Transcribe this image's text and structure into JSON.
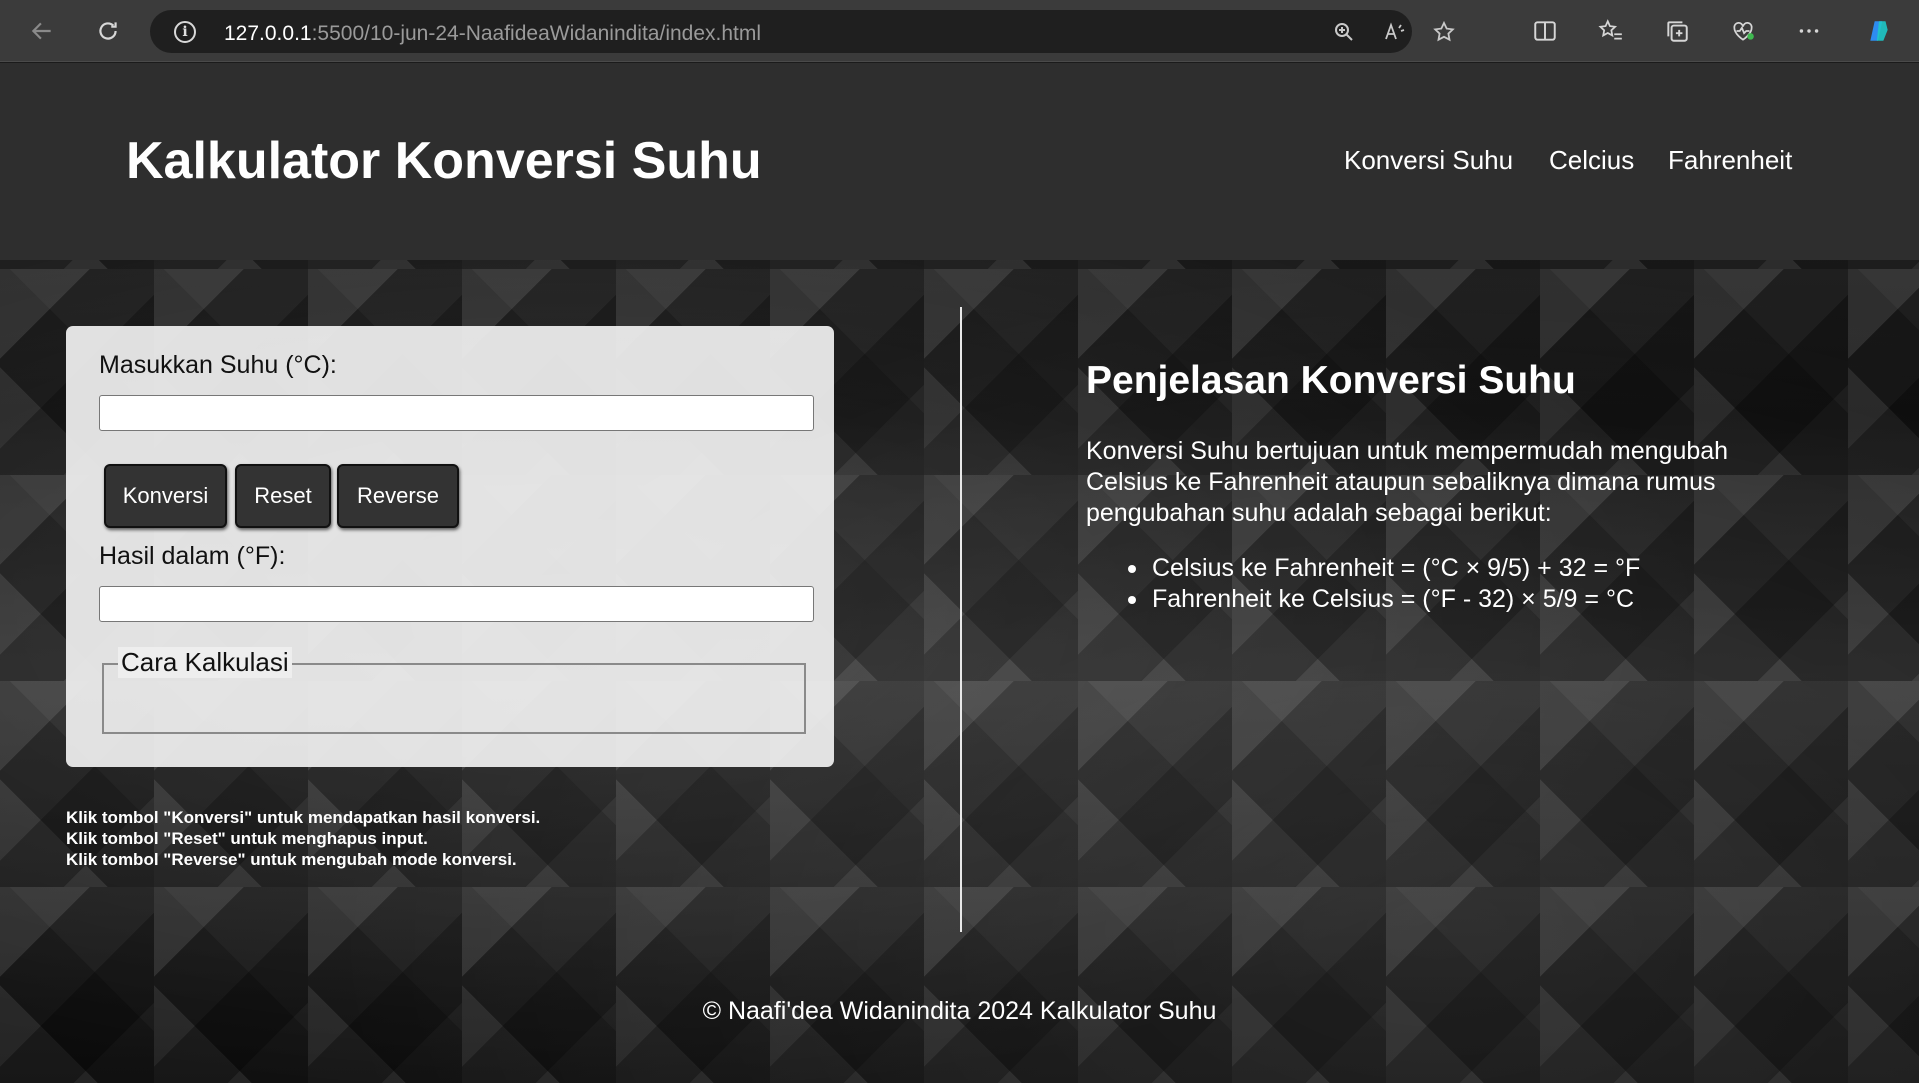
{
  "browser": {
    "url_host": "127.0.0.1",
    "url_rest": ":5500/10-jun-24-NaafideaWidanindita/index.html"
  },
  "header": {
    "title": "Kalkulator Konversi Suhu",
    "nav": [
      {
        "label": "Konversi Suhu"
      },
      {
        "label": "Celcius"
      },
      {
        "label": "Fahrenheit"
      }
    ]
  },
  "calculator": {
    "input_label": "Masukkan Suhu (°C):",
    "input_value": "",
    "buttons": {
      "convert": "Konversi",
      "reset": "Reset",
      "reverse": "Reverse"
    },
    "result_label": "Hasil dalam (°F):",
    "result_value": "",
    "method_legend": "Cara Kalkulasi"
  },
  "instructions": [
    "Klik tombol \"Konversi\" untuk mendapatkan hasil konversi.",
    "Klik tombol \"Reset\" untuk menghapus input.",
    "Klik tombol \"Reverse\" untuk mengubah mode konversi."
  ],
  "explanation": {
    "title": "Penjelasan Konversi Suhu",
    "text": "Konversi Suhu bertujuan untuk mempermudah mengubah Celsius ke Fahrenheit ataupun sebaliknya dimana rumus pengubahan suhu adalah sebagai berikut:",
    "formulas": [
      "Celsius ke Fahrenheit = (°C × 9/5) + 32 = °F",
      "Fahrenheit ke Celsius = (°F - 32) × 5/9 = °C"
    ]
  },
  "footer": {
    "text": "© Naafi'dea Widanindita 2024 Kalkulator Suhu"
  }
}
